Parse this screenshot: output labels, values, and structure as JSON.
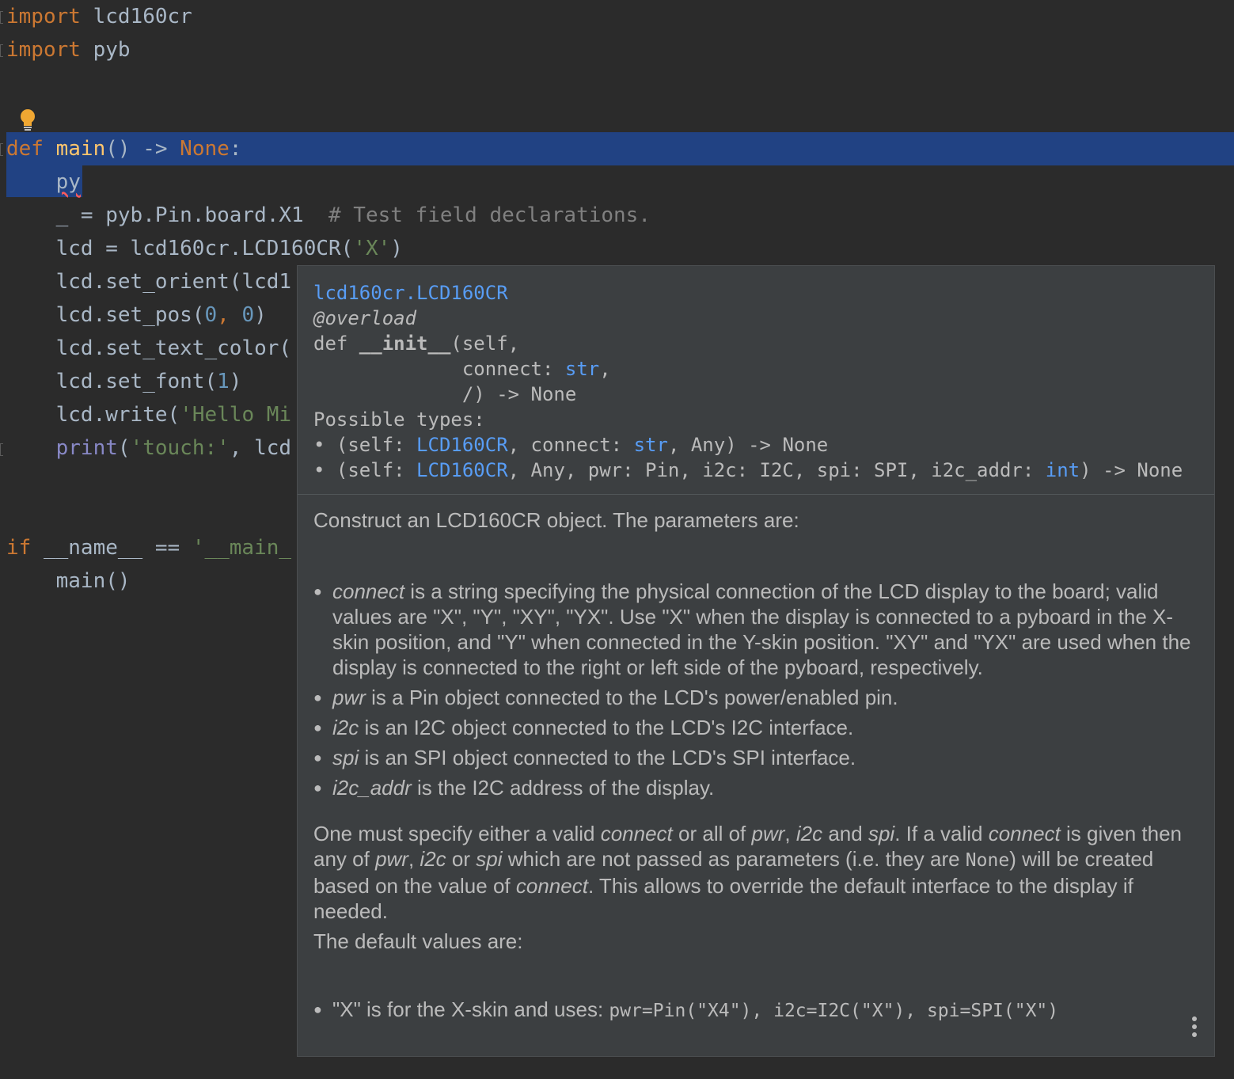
{
  "editor": {
    "l1_kw": "import",
    "l1_mod": " lcd160cr",
    "l2_kw": "import",
    "l2_mod": " pyb",
    "l4_kw": "def",
    "l4_name": "main",
    "l4_rest": "() -> ",
    "l4_ret": "None",
    "l4_colon": ":",
    "l5_text": "py",
    "l6_a": "_ = pyb.Pin.board.X1  ",
    "l6_cm": "# Test field declarations.",
    "l7_a": "lcd = lcd160cr.LCD160CR(",
    "l7_str": "'X'",
    "l7_b": ")",
    "l8_a": "lcd.set_orient(lcd1",
    "l9_a": "lcd.set_pos(",
    "l9_n1": "0",
    "l9_c": ", ",
    "l9_n2": "0",
    "l9_b": ")",
    "l10_a": "lcd.set_text_color(",
    "l11_a": "lcd.set_font(",
    "l11_n": "1",
    "l11_b": ")",
    "l12_a": "lcd.write(",
    "l12_str": "'Hello Mi",
    "l13_bi": "print",
    "l13_a": "(",
    "l13_str": "'touch:'",
    "l13_b": ", lcd",
    "l15_kw": "if",
    "l15_a": " __name__ == ",
    "l15_str": "'__main_",
    "l16_a": "main()"
  },
  "popup": {
    "sig": {
      "path": "lcd160cr.LCD160CR",
      "decorator": "@overload",
      "def_kw": "def ",
      "def_name": "__init__",
      "def_rest": "(self,",
      "connect_pre": "             connect: ",
      "connect_type": "str",
      "connect_post": ",",
      "close_line": "             /) -> None",
      "possible": "Possible types:",
      "t1_a": "• (self: ",
      "t1_cls": "LCD160CR",
      "t1_b": ", connect: ",
      "t1_str": "str",
      "t1_c": ", Any) -> None",
      "t2_a": "• (self: ",
      "t2_cls": "LCD160CR",
      "t2_b": ", Any, pwr: Pin, i2c: I2C, spi: SPI, i2c_addr: ",
      "t2_int": "int",
      "t2_c": ") -> None"
    },
    "doc": {
      "intro": "Construct an LCD160CR object. The parameters are:",
      "b1_term": "connect",
      "b1_text": " is a string specifying the physical connection of the LCD display to the board; valid values are \"X\", \"Y\", \"XY\", \"YX\". Use \"X\" when the display is connected to a pyboard in the X-skin position, and \"Y\" when connected in the Y-skin position. \"XY\" and \"YX\" are used when the display is connected to the right or left side of the pyboard, respectively.",
      "b2_term": "pwr",
      "b2_text": " is a Pin object connected to the LCD's power/enabled pin.",
      "b3_term": "i2c",
      "b3_text": " is an I2C object connected to the LCD's I2C interface.",
      "b4_term": "spi",
      "b4_text": " is an SPI object connected to the LCD's SPI interface.",
      "b5_term": "i2c_addr",
      "b5_text": " is the I2C address of the display.",
      "p2_1": "One must specify either a valid ",
      "p2_connect": "connect",
      "p2_2": " or all of ",
      "p2_pwr": "pwr",
      "p2_3": ", ",
      "p2_i2c": "i2c",
      "p2_4": " and ",
      "p2_spi": "spi",
      "p2_5": ". If a valid ",
      "p2_connect2": "connect",
      "p2_6": " is given then any of ",
      "p2_pwr2": "pwr",
      "p2_7": ", ",
      "p2_i2c2": "i2c",
      "p2_8": " or ",
      "p2_spi2": "spi",
      "p2_9": " which are not passed as parameters (i.e. they are ",
      "p2_none": "None",
      "p2_10": ") will be created based on the value of ",
      "p2_connect3": "connect",
      "p2_11": ". This allows to override the default interface to the display if needed.",
      "defaults": "The default values are:",
      "d1_a": "\"X\" is for the X-skin and uses: ",
      "d1_code": "pwr=Pin(\"X4\"), i2c=I2C(\"X\"), spi=SPI(\"X\")"
    }
  }
}
